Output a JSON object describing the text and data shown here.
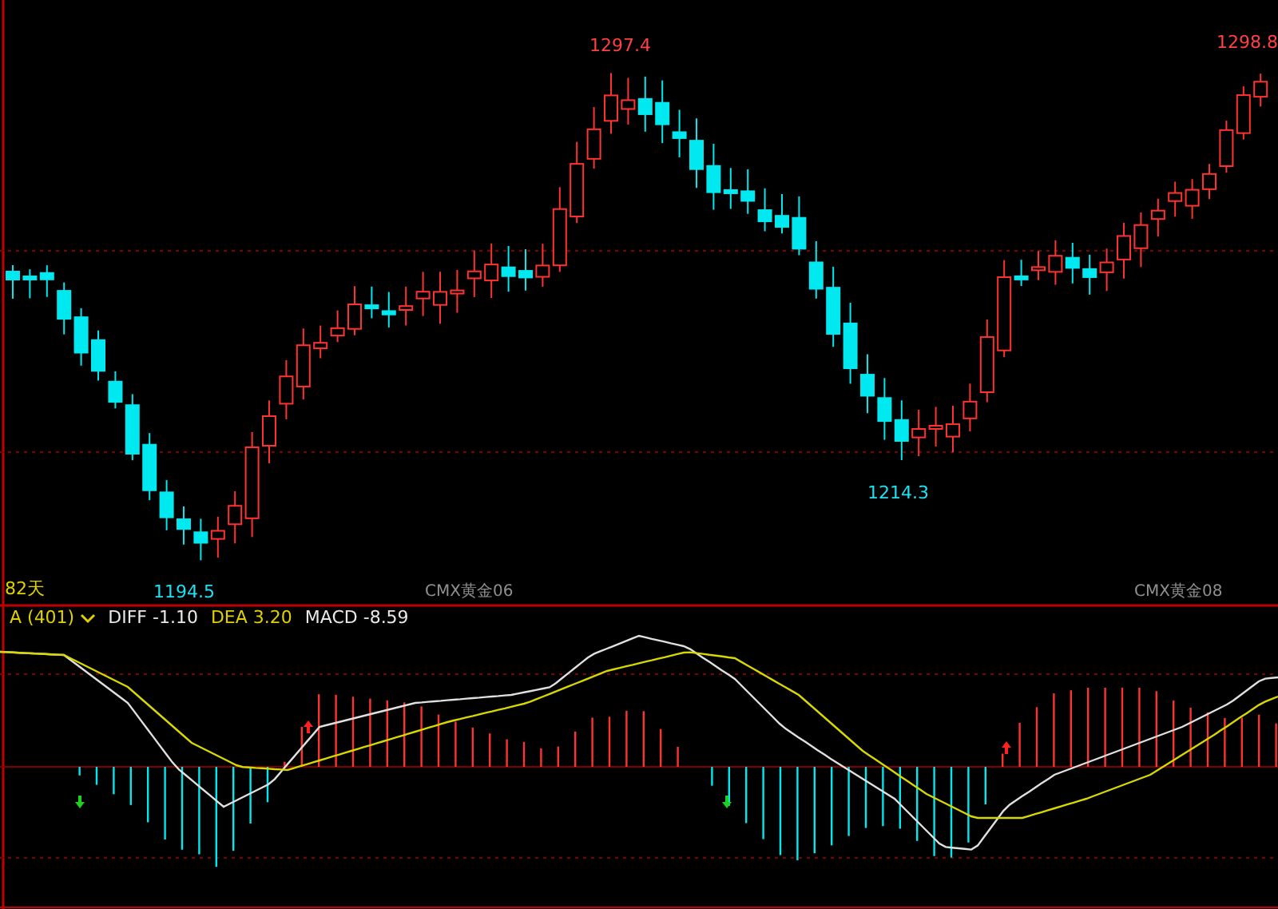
{
  "price_panel": {
    "extreme_labels": [
      {
        "text": "1297.4",
        "kind": "high"
      },
      {
        "text": "1298.8",
        "kind": "high"
      },
      {
        "text": "1194.5",
        "kind": "low"
      },
      {
        "text": "1214.3",
        "kind": "low"
      }
    ],
    "period_label": "82天",
    "contract_labels": [
      "CMX黄金06",
      "CMX黄金08"
    ]
  },
  "indicator_panel": {
    "selector": "A (401)",
    "legend": [
      {
        "text": "DIFF -1.10",
        "kind": "diff"
      },
      {
        "text": "DEA 3.20",
        "kind": "dea"
      },
      {
        "text": "MACD -8.59",
        "kind": "macd"
      }
    ],
    "signals": [
      {
        "kind": "buy"
      },
      {
        "kind": "buy"
      },
      {
        "kind": "sell"
      },
      {
        "kind": "sell"
      }
    ]
  }
}
